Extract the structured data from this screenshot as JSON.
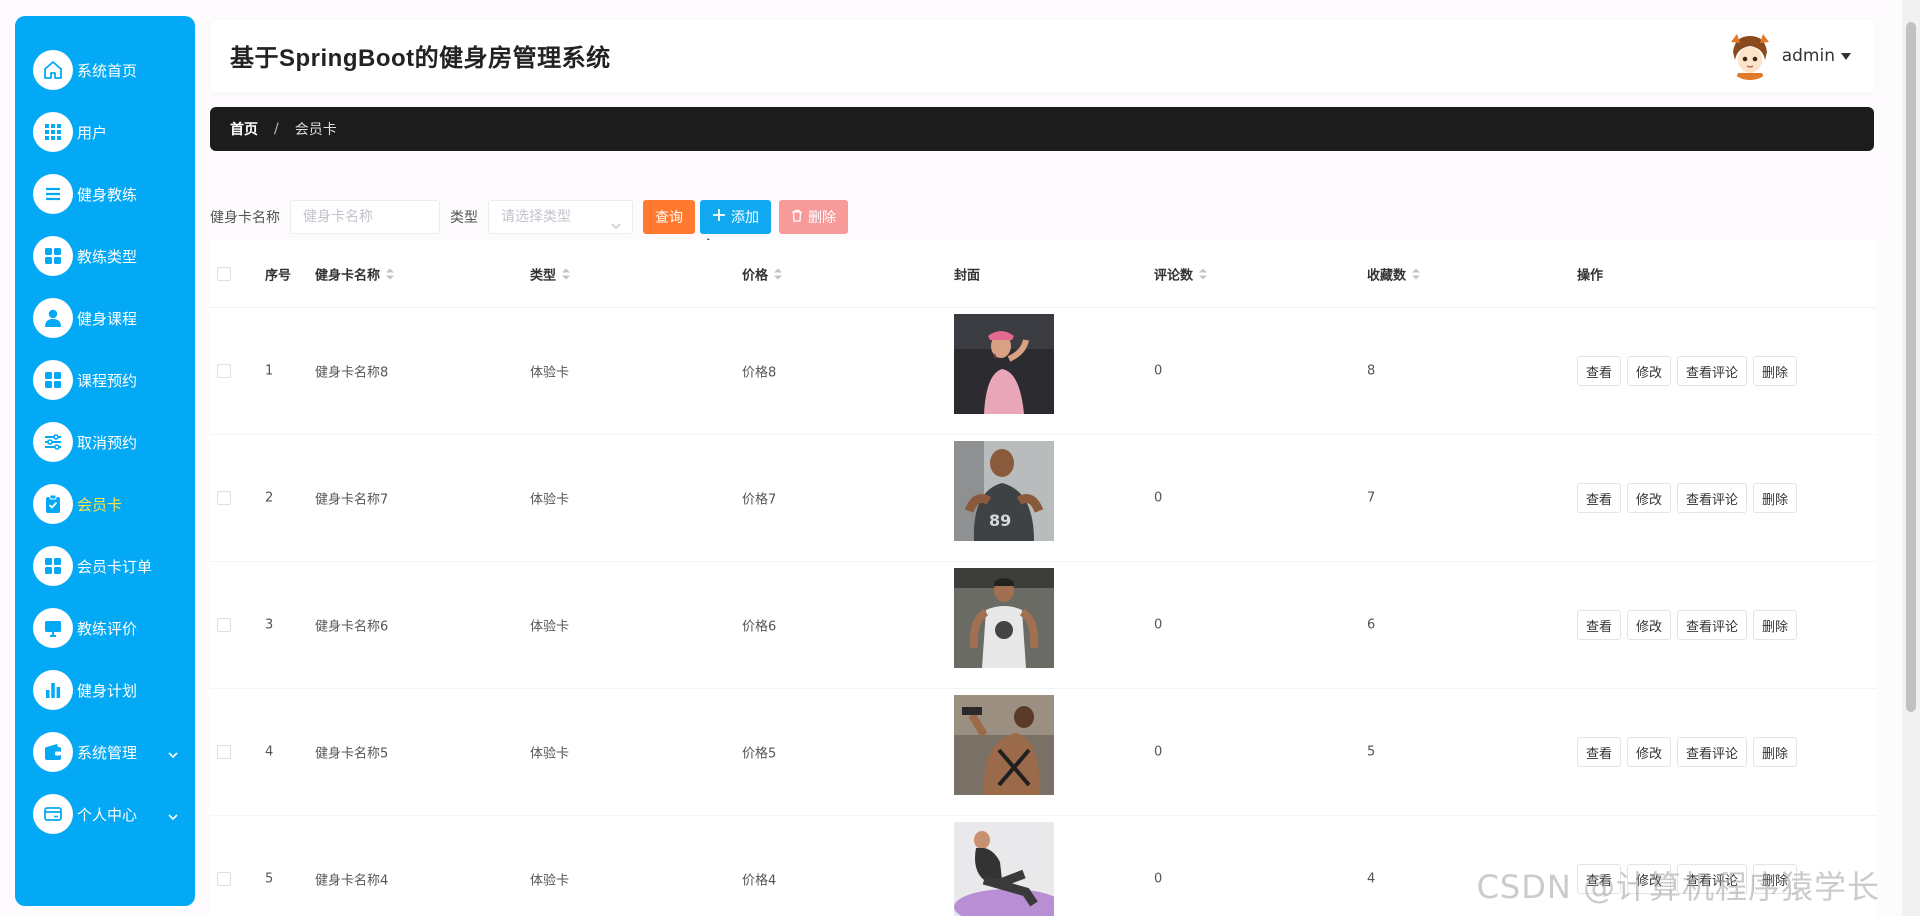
{
  "app": {
    "title": "基于SpringBoot的健身房管理系统",
    "user_name": "admin"
  },
  "sidebar": {
    "items": [
      {
        "label": "系统首页",
        "icon": "home-icon"
      },
      {
        "label": "用户",
        "icon": "grid-icon"
      },
      {
        "label": "健身教练",
        "icon": "list-icon"
      },
      {
        "label": "教练类型",
        "icon": "apps-icon"
      },
      {
        "label": "健身课程",
        "icon": "user-icon"
      },
      {
        "label": "课程预约",
        "icon": "apps-icon"
      },
      {
        "label": "取消预约",
        "icon": "sliders-icon"
      },
      {
        "label": "会员卡",
        "icon": "clipboard-check-icon",
        "active": true
      },
      {
        "label": "会员卡订单",
        "icon": "apps-icon"
      },
      {
        "label": "教练评价",
        "icon": "monitor-icon"
      },
      {
        "label": "健身计划",
        "icon": "bar-chart-icon"
      },
      {
        "label": "系统管理",
        "icon": "wallet-icon",
        "expandable": true
      },
      {
        "label": "个人中心",
        "icon": "card-icon",
        "expandable": true
      }
    ],
    "active_color": "#ffe14d",
    "bg_color": "#03a9f4"
  },
  "breadcrumb": {
    "home": "首页",
    "separator": "/",
    "current": "会员卡"
  },
  "search": {
    "name_label": "健身卡名称",
    "name_placeholder": "健身卡名称",
    "type_label": "类型",
    "type_placeholder": "请选择类型",
    "query_button": "查询",
    "add_button": "添加",
    "delete_button": "删除"
  },
  "table": {
    "headers": {
      "index": "序号",
      "name": "健身卡名称",
      "type": "类型",
      "price": "价格",
      "cover": "封面",
      "comments": "评论数",
      "favorites": "收藏数",
      "actions": "操作"
    },
    "rows": [
      {
        "index": "1",
        "name": "健身卡名称8",
        "type": "体验卡",
        "price": "价格8",
        "comments": "0",
        "favorites": "8"
      },
      {
        "index": "2",
        "name": "健身卡名称7",
        "type": "体验卡",
        "price": "价格7",
        "comments": "0",
        "favorites": "7"
      },
      {
        "index": "3",
        "name": "健身卡名称6",
        "type": "体验卡",
        "price": "价格6",
        "comments": "0",
        "favorites": "6"
      },
      {
        "index": "4",
        "name": "健身卡名称5",
        "type": "体验卡",
        "price": "价格5",
        "comments": "0",
        "favorites": "5"
      },
      {
        "index": "5",
        "name": "健身卡名称4",
        "type": "体验卡",
        "price": "价格4",
        "comments": "0",
        "favorites": "4"
      }
    ],
    "row_actions": {
      "view": "查看",
      "edit": "修改",
      "view_comments": "查看评论",
      "delete": "删除"
    }
  },
  "watermark": "CSDN @计算机程序猿学长",
  "colors": {
    "accent": "#03a9f4",
    "query": "#ff7a2f",
    "add": "#12a9f0",
    "delete": "#f79a9a",
    "breadcrumb_bg": "#1c1c1c"
  }
}
